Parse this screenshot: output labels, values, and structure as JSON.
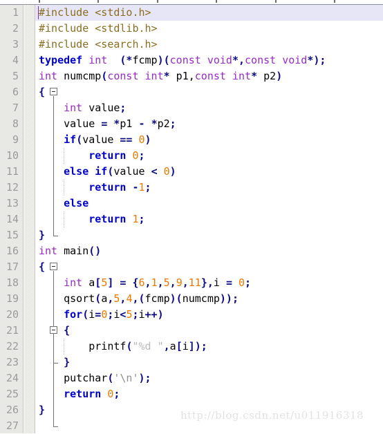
{
  "app": {
    "kind": "code-editor",
    "language": "C",
    "current_line": 1
  },
  "colors": {
    "background": "#ffffff",
    "gutter_background": "#e8e8e4",
    "line_number": "#9b9b9b",
    "current_line_highlight": "#e6e6f7",
    "keyword": "#0000cd",
    "type": "#9a29c9",
    "preprocessor": "#8a6d1f",
    "number": "#ee7700",
    "punctuation": "#0b0b8a",
    "string": "#b9b9b9",
    "identifier": "#000000",
    "caret": "#7a2fb0",
    "watermark": "#e2e2e2"
  },
  "watermark": {
    "text": "http://blog.csdn.net/u011916318"
  },
  "ruler": {
    "ticks": [
      56,
      141,
      227,
      312,
      398,
      483
    ]
  },
  "lines": [
    {
      "n": "1",
      "indent": 0,
      "tokens": [
        {
          "t": "#include <stdio.h>",
          "c": "pp"
        }
      ]
    },
    {
      "n": "2",
      "indent": 0,
      "tokens": [
        {
          "t": "#include <stdlib.h>",
          "c": "pp"
        }
      ]
    },
    {
      "n": "3",
      "indent": 0,
      "tokens": [
        {
          "t": "#include <search.h>",
          "c": "pp"
        }
      ]
    },
    {
      "n": "4",
      "indent": 0,
      "tokens": [
        {
          "t": "typedef",
          "c": "kw"
        },
        {
          "t": " ",
          "c": "id"
        },
        {
          "t": "int",
          "c": "ty"
        },
        {
          "t": "  ",
          "c": "id"
        },
        {
          "t": "(*",
          "c": "pun"
        },
        {
          "t": "fcmp",
          "c": "id"
        },
        {
          "t": ")(",
          "c": "pun"
        },
        {
          "t": "const",
          "c": "ty"
        },
        {
          "t": " ",
          "c": "id"
        },
        {
          "t": "void",
          "c": "ty"
        },
        {
          "t": "*,",
          "c": "pun"
        },
        {
          "t": "const",
          "c": "ty"
        },
        {
          "t": " ",
          "c": "id"
        },
        {
          "t": "void",
          "c": "ty"
        },
        {
          "t": "*);",
          "c": "pun"
        }
      ]
    },
    {
      "n": "5",
      "indent": 0,
      "tokens": [
        {
          "t": "int",
          "c": "ty"
        },
        {
          "t": " numcmp",
          "c": "id"
        },
        {
          "t": "(",
          "c": "pun"
        },
        {
          "t": "const",
          "c": "ty"
        },
        {
          "t": " ",
          "c": "id"
        },
        {
          "t": "int",
          "c": "ty"
        },
        {
          "t": "*",
          "c": "pun"
        },
        {
          "t": " p1,",
          "c": "id"
        },
        {
          "t": "const",
          "c": "ty"
        },
        {
          "t": " ",
          "c": "id"
        },
        {
          "t": "int",
          "c": "ty"
        },
        {
          "t": "*",
          "c": "pun"
        },
        {
          "t": " p2",
          "c": "id"
        },
        {
          "t": ")",
          "c": "pun"
        }
      ]
    },
    {
      "n": "6",
      "indent": 0,
      "tokens": [
        {
          "t": "{",
          "c": "pun"
        }
      ]
    },
    {
      "n": "7",
      "indent": 0,
      "tokens": [
        {
          "t": "    ",
          "c": "id"
        },
        {
          "t": "int",
          "c": "ty"
        },
        {
          "t": " value",
          "c": "id"
        },
        {
          "t": ";",
          "c": "pun"
        }
      ]
    },
    {
      "n": "8",
      "indent": 0,
      "tokens": [
        {
          "t": "    value ",
          "c": "id"
        },
        {
          "t": "=",
          "c": "pun"
        },
        {
          "t": " ",
          "c": "id"
        },
        {
          "t": "*",
          "c": "pun"
        },
        {
          "t": "p1 ",
          "c": "id"
        },
        {
          "t": "-",
          "c": "pun"
        },
        {
          "t": " ",
          "c": "id"
        },
        {
          "t": "*",
          "c": "pun"
        },
        {
          "t": "p2",
          "c": "id"
        },
        {
          "t": ";",
          "c": "pun"
        }
      ]
    },
    {
      "n": "9",
      "indent": 0,
      "tokens": [
        {
          "t": "    ",
          "c": "id"
        },
        {
          "t": "if",
          "c": "kw"
        },
        {
          "t": "(",
          "c": "pun"
        },
        {
          "t": "value ",
          "c": "id"
        },
        {
          "t": "==",
          "c": "pun"
        },
        {
          "t": " ",
          "c": "id"
        },
        {
          "t": "0",
          "c": "num"
        },
        {
          "t": ")",
          "c": "pun"
        }
      ]
    },
    {
      "n": "10",
      "indent": 0,
      "tokens": [
        {
          "t": "        ",
          "c": "id"
        },
        {
          "t": "return",
          "c": "kw"
        },
        {
          "t": " ",
          "c": "id"
        },
        {
          "t": "0",
          "c": "num"
        },
        {
          "t": ";",
          "c": "pun"
        }
      ]
    },
    {
      "n": "11",
      "indent": 0,
      "tokens": [
        {
          "t": "    ",
          "c": "id"
        },
        {
          "t": "else",
          "c": "kw"
        },
        {
          "t": " ",
          "c": "id"
        },
        {
          "t": "if",
          "c": "kw"
        },
        {
          "t": "(",
          "c": "pun"
        },
        {
          "t": "value ",
          "c": "id"
        },
        {
          "t": "<",
          "c": "pun"
        },
        {
          "t": " ",
          "c": "id"
        },
        {
          "t": "0",
          "c": "num"
        },
        {
          "t": ")",
          "c": "pun"
        }
      ]
    },
    {
      "n": "12",
      "indent": 0,
      "tokens": [
        {
          "t": "        ",
          "c": "id"
        },
        {
          "t": "return",
          "c": "kw"
        },
        {
          "t": " ",
          "c": "id"
        },
        {
          "t": "-",
          "c": "pun"
        },
        {
          "t": "1",
          "c": "num"
        },
        {
          "t": ";",
          "c": "pun"
        }
      ]
    },
    {
      "n": "13",
      "indent": 0,
      "tokens": [
        {
          "t": "    ",
          "c": "id"
        },
        {
          "t": "else",
          "c": "kw"
        }
      ]
    },
    {
      "n": "14",
      "indent": 0,
      "tokens": [
        {
          "t": "        ",
          "c": "id"
        },
        {
          "t": "return",
          "c": "kw"
        },
        {
          "t": " ",
          "c": "id"
        },
        {
          "t": "1",
          "c": "num"
        },
        {
          "t": ";",
          "c": "pun"
        }
      ]
    },
    {
      "n": "15",
      "indent": 0,
      "tokens": [
        {
          "t": "}",
          "c": "pun"
        }
      ]
    },
    {
      "n": "16",
      "indent": 0,
      "tokens": [
        {
          "t": "int",
          "c": "ty"
        },
        {
          "t": " main",
          "c": "id"
        },
        {
          "t": "()",
          "c": "pun"
        }
      ]
    },
    {
      "n": "17",
      "indent": 0,
      "tokens": [
        {
          "t": "{",
          "c": "pun"
        }
      ]
    },
    {
      "n": "18",
      "indent": 0,
      "tokens": [
        {
          "t": "    ",
          "c": "id"
        },
        {
          "t": "int",
          "c": "ty"
        },
        {
          "t": " a",
          "c": "id"
        },
        {
          "t": "[",
          "c": "pun"
        },
        {
          "t": "5",
          "c": "num"
        },
        {
          "t": "] = {",
          "c": "pun"
        },
        {
          "t": "6",
          "c": "num"
        },
        {
          "t": ",",
          "c": "pun"
        },
        {
          "t": "1",
          "c": "num"
        },
        {
          "t": ",",
          "c": "pun"
        },
        {
          "t": "5",
          "c": "num"
        },
        {
          "t": ",",
          "c": "pun"
        },
        {
          "t": "9",
          "c": "num"
        },
        {
          "t": ",",
          "c": "pun"
        },
        {
          "t": "11",
          "c": "num"
        },
        {
          "t": "},",
          "c": "pun"
        },
        {
          "t": "i ",
          "c": "id"
        },
        {
          "t": "=",
          "c": "pun"
        },
        {
          "t": " ",
          "c": "id"
        },
        {
          "t": "0",
          "c": "num"
        },
        {
          "t": ";",
          "c": "pun"
        }
      ]
    },
    {
      "n": "19",
      "indent": 0,
      "tokens": [
        {
          "t": "    qsort",
          "c": "id"
        },
        {
          "t": "(",
          "c": "pun"
        },
        {
          "t": "a",
          "c": "id"
        },
        {
          "t": ",",
          "c": "pun"
        },
        {
          "t": "5",
          "c": "num"
        },
        {
          "t": ",",
          "c": "pun"
        },
        {
          "t": "4",
          "c": "num"
        },
        {
          "t": ",(",
          "c": "pun"
        },
        {
          "t": "fcmp",
          "c": "id"
        },
        {
          "t": ")(",
          "c": "pun"
        },
        {
          "t": "numcmp",
          "c": "id"
        },
        {
          "t": "));",
          "c": "pun"
        }
      ]
    },
    {
      "n": "20",
      "indent": 0,
      "tokens": [
        {
          "t": "    ",
          "c": "id"
        },
        {
          "t": "for",
          "c": "kw"
        },
        {
          "t": "(",
          "c": "pun"
        },
        {
          "t": "i",
          "c": "id"
        },
        {
          "t": "=",
          "c": "pun"
        },
        {
          "t": "0",
          "c": "num"
        },
        {
          "t": ";",
          "c": "pun"
        },
        {
          "t": "i",
          "c": "id"
        },
        {
          "t": "<",
          "c": "pun"
        },
        {
          "t": "5",
          "c": "num"
        },
        {
          "t": ";",
          "c": "pun"
        },
        {
          "t": "i",
          "c": "id"
        },
        {
          "t": "++)",
          "c": "pun"
        }
      ]
    },
    {
      "n": "21",
      "indent": 0,
      "tokens": [
        {
          "t": "    ",
          "c": "id"
        },
        {
          "t": "{",
          "c": "pun"
        }
      ]
    },
    {
      "n": "22",
      "indent": 0,
      "tokens": [
        {
          "t": "        printf",
          "c": "id"
        },
        {
          "t": "(",
          "c": "pun"
        },
        {
          "t": "\"%d \"",
          "c": "str"
        },
        {
          "t": ",",
          "c": "pun"
        },
        {
          "t": "a",
          "c": "id"
        },
        {
          "t": "[",
          "c": "pun"
        },
        {
          "t": "i",
          "c": "id"
        },
        {
          "t": "]);",
          "c": "pun"
        }
      ]
    },
    {
      "n": "23",
      "indent": 0,
      "tokens": [
        {
          "t": "    ",
          "c": "id"
        },
        {
          "t": "}",
          "c": "pun"
        }
      ]
    },
    {
      "n": "24",
      "indent": 0,
      "tokens": [
        {
          "t": "    putchar",
          "c": "id"
        },
        {
          "t": "(",
          "c": "pun"
        },
        {
          "t": "'\\n'",
          "c": "chr"
        },
        {
          "t": ");",
          "c": "pun"
        }
      ]
    },
    {
      "n": "25",
      "indent": 0,
      "tokens": [
        {
          "t": "    ",
          "c": "id"
        },
        {
          "t": "return",
          "c": "kw"
        },
        {
          "t": " ",
          "c": "id"
        },
        {
          "t": "0",
          "c": "num"
        },
        {
          "t": ";",
          "c": "pun"
        }
      ]
    },
    {
      "n": "26",
      "indent": 0,
      "tokens": [
        {
          "t": "}",
          "c": "pun"
        }
      ]
    },
    {
      "n": "27",
      "indent": 0,
      "tokens": []
    }
  ],
  "fold_markers": [
    {
      "line": 6,
      "kind": "collapse-box"
    },
    {
      "line": 17,
      "kind": "collapse-box"
    },
    {
      "line": 21,
      "kind": "collapse-box"
    }
  ],
  "fold_regions": [
    {
      "from_line": 6,
      "to_line": 15
    },
    {
      "from_line": 17,
      "to_line": 27
    },
    {
      "from_line": 21,
      "to_line": 23
    }
  ],
  "indent_guides": [
    {
      "from_line": 10,
      "to_line": 10,
      "col": 1
    },
    {
      "from_line": 12,
      "to_line": 12,
      "col": 1
    },
    {
      "from_line": 14,
      "to_line": 14,
      "col": 1
    },
    {
      "from_line": 22,
      "to_line": 22,
      "col": 1
    }
  ]
}
